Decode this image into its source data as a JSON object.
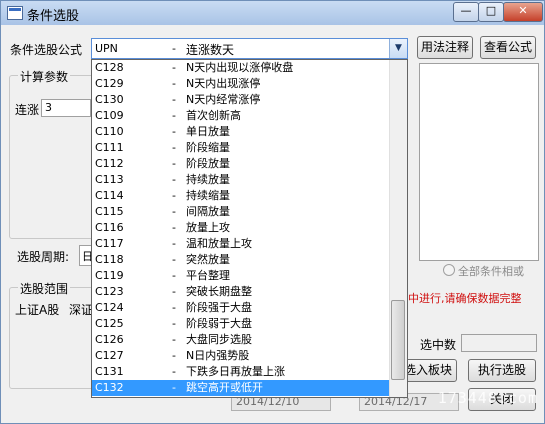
{
  "window": {
    "title": "条件选股",
    "min_label": "—",
    "max_label": "□",
    "close_label": "✕"
  },
  "formula": {
    "label": "条件选股公式",
    "selected_code": "UPN",
    "selected_name": "连涨数天"
  },
  "buttons": {
    "usage": "用法注释",
    "view_formula": "查看公式",
    "import_board": "选入板块",
    "execute": "执行选股",
    "close": "关闭"
  },
  "params_group": {
    "legend": "计算参数",
    "streak_label": "连涨",
    "streak_value": "3"
  },
  "period": {
    "label": "选股周期:",
    "value": "日"
  },
  "all_conditions": "全部条件相或",
  "warning": "中进行,请确保数据完整",
  "range_group": {
    "legend": "选股范围",
    "items": [
      "上证A股",
      "深证"
    ]
  },
  "selected_count_label": "选中数",
  "dates": [
    "2014/12/10",
    "2014/12/17"
  ],
  "watermark": "173448.com",
  "dropdown": {
    "items": [
      {
        "code": "C128",
        "dash": "-",
        "name": "N天内出现以涨停收盘"
      },
      {
        "code": "C129",
        "dash": "-",
        "name": "N天内出现涨停"
      },
      {
        "code": "C130",
        "dash": "-",
        "name": "N天内经常涨停"
      },
      {
        "code": "C109",
        "dash": "-",
        "name": "首次创新高"
      },
      {
        "code": "C110",
        "dash": "-",
        "name": "单日放量"
      },
      {
        "code": "C111",
        "dash": "-",
        "name": "阶段缩量"
      },
      {
        "code": "C112",
        "dash": "-",
        "name": "阶段放量"
      },
      {
        "code": "C113",
        "dash": "-",
        "name": "持续放量"
      },
      {
        "code": "C114",
        "dash": "-",
        "name": "持续缩量"
      },
      {
        "code": "C115",
        "dash": "-",
        "name": "间隔放量"
      },
      {
        "code": "C116",
        "dash": "-",
        "name": "放量上攻"
      },
      {
        "code": "C117",
        "dash": "-",
        "name": "温和放量上攻"
      },
      {
        "code": "C118",
        "dash": "-",
        "name": "突然放量"
      },
      {
        "code": "C119",
        "dash": "-",
        "name": "平台整理"
      },
      {
        "code": "C123",
        "dash": "-",
        "name": "突破长期盘整"
      },
      {
        "code": "C124",
        "dash": "-",
        "name": "阶段强于大盘"
      },
      {
        "code": "C125",
        "dash": "-",
        "name": "阶段弱于大盘"
      },
      {
        "code": "C126",
        "dash": "-",
        "name": "大盘同步选股"
      },
      {
        "code": "C127",
        "dash": "-",
        "name": "N日内强势股"
      },
      {
        "code": "C131",
        "dash": "-",
        "name": "下跌多日再放量上涨"
      },
      {
        "code": "C132",
        "dash": "-",
        "name": "跳空高开或低开"
      }
    ],
    "selected_index": 20
  }
}
